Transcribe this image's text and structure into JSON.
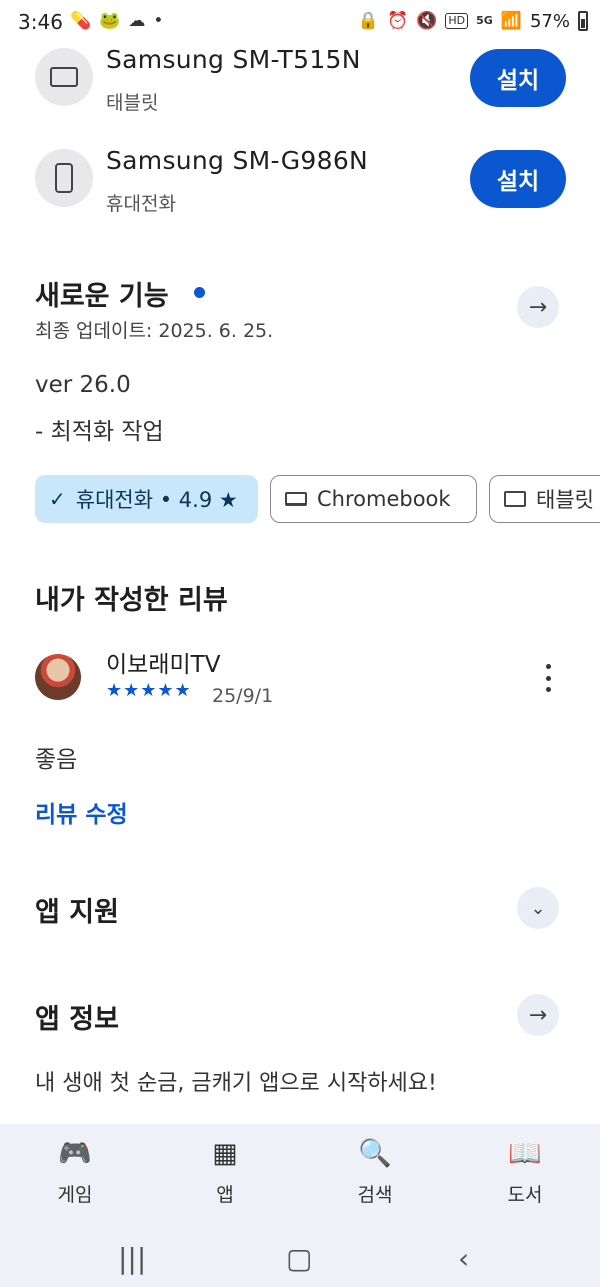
{
  "status_bar": {
    "time": "3:46",
    "battery": "57%",
    "left_icons": [
      "pill-icon",
      "mascot-icon",
      "cloud-icon",
      "dot-icon"
    ],
    "right_icons": [
      "lock-icon",
      "alarm-icon",
      "mute-icon",
      "hd-icon",
      "5g-icon",
      "signal-icon",
      "battery-icon"
    ],
    "hd": "HD",
    "net": "5G"
  },
  "devices": [
    {
      "name": "Samsung SM-T515N",
      "type": "태블릿",
      "button": "설치",
      "icon": "tablet-icon"
    },
    {
      "name": "Samsung SM-G986N",
      "type": "휴대전화",
      "button": "설치",
      "icon": "phone-icon"
    }
  ],
  "whats_new": {
    "title": "새로운 기능",
    "updated": "최종 업데이트: 2025. 6. 25.",
    "version": "ver 26.0",
    "note": "- 최적화 작업"
  },
  "chips": {
    "phone": "휴대전화 • 4.9 ★",
    "chromebook": "Chromebook",
    "tablet": "태블릿"
  },
  "my_review": {
    "title": "내가 작성한 리뷰",
    "reviewer": "이보래미TV",
    "stars": "★★★★★",
    "rating": 5,
    "date": "25/9/1",
    "text": "좋음",
    "edit": "리뷰 수정"
  },
  "app_support": {
    "title": "앱 지원"
  },
  "app_info": {
    "title": "앱 정보",
    "description": "내 생애 첫 순금, 금캐기 앱으로 시작하세요!"
  },
  "bottom_nav": [
    {
      "label": "게임",
      "icon": "gamepad-icon"
    },
    {
      "label": "앱",
      "icon": "apps-grid-icon"
    },
    {
      "label": "검색",
      "icon": "search-icon"
    },
    {
      "label": "도서",
      "icon": "book-icon"
    }
  ],
  "colors": {
    "accent": "#0b57d0",
    "chip_selected_bg": "#c9e7fb",
    "nav_bg": "#eef1f8"
  }
}
